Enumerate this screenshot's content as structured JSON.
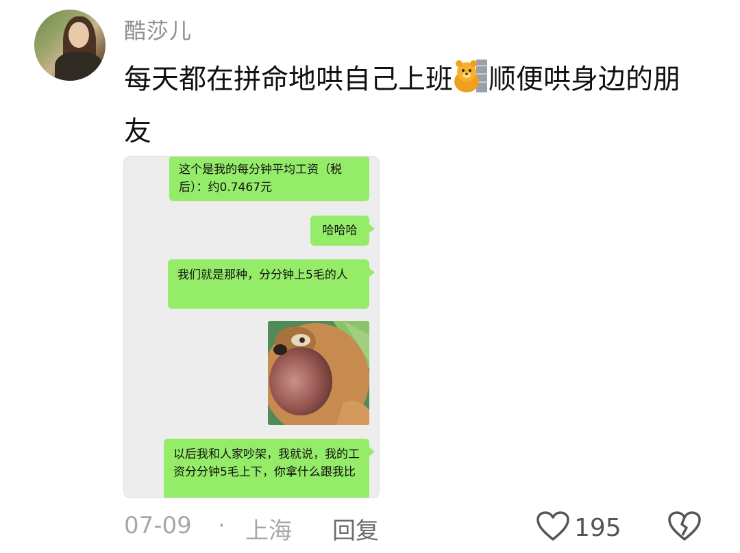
{
  "comment": {
    "username": "酷莎儿",
    "text_before_emoji": "每天都在拼命地哄自己上班",
    "emoji": "bear-at-wall-emoji",
    "text_after_emoji": "顺便哄身边的朋友",
    "chat_screenshot": {
      "messages": [
        {
          "text": "这个是我的每分钟平均工资（税后）：约0.7467元"
        },
        {
          "text": "哈哈哈"
        },
        {
          "text": "我们就是那种，分分钟上5毛的人"
        },
        {
          "sticker": "bear-face-sticker"
        },
        {
          "text": "以后我和人家吵架，我就说，我的工资分分钟5毛上下，你拿什么跟我比"
        }
      ]
    },
    "date": "07-09",
    "separator": "·",
    "location": "上海",
    "reply_label": "回复",
    "like_count": "195"
  },
  "icons": {
    "like": "heart-outline-icon",
    "dislike": "broken-heart-icon"
  },
  "colors": {
    "bubble_green": "#95ec69",
    "chat_bg": "#ededed",
    "meta_gray": "#a7a7ab"
  }
}
